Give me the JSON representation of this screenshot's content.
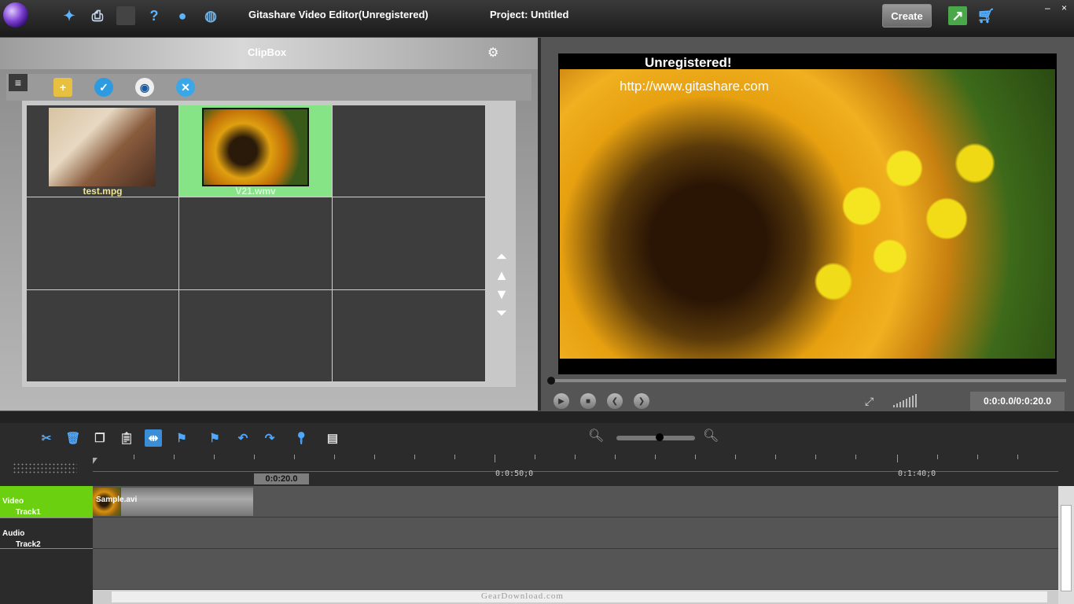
{
  "app": {
    "title": "Gitashare Video Editor(Unregistered)",
    "project": "Project: Untitled",
    "create_label": "Create",
    "minimize": "–",
    "close": "×"
  },
  "toolbar_icons": [
    "new-project-icon",
    "print-icon",
    "monitor-icon",
    "help-icon",
    "chat-icon",
    "globe-icon",
    "edit-icon",
    "cart-icon"
  ],
  "clipbox": {
    "title": "ClipBox",
    "items": [
      {
        "label": "test.mpg",
        "selected": false
      },
      {
        "label": "V21.wmv",
        "selected": true
      }
    ]
  },
  "player": {
    "watermark1": "Unregistered!",
    "watermark2": "http://www.gitashare.com",
    "timecode": "0:0:0.0/0:0:20.0"
  },
  "timeline": {
    "playhead": "0:0:20.0",
    "ruler_label_1": "0:0:50;0",
    "ruler_label_2": "0:1:40;0",
    "video_track": {
      "title": "Video",
      "sub": "Track1",
      "clip": "Sample.avi"
    },
    "audio_track": {
      "title": "Audio",
      "sub": "Track2"
    }
  },
  "footer": {
    "watermark": "GearDownload.com"
  }
}
